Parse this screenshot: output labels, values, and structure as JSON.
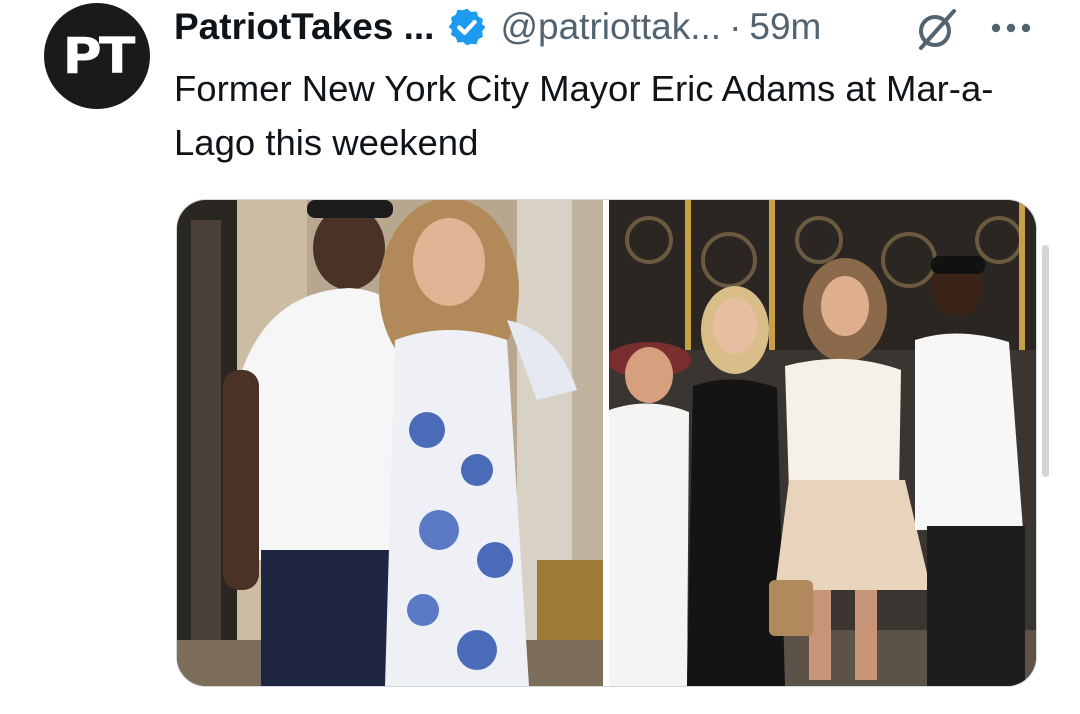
{
  "post": {
    "avatar": {
      "initials": "PT",
      "background": "#1a1a1a"
    },
    "author": {
      "display_name": "PatriotTakes ...",
      "verified": true,
      "handle": "@patriottak...",
      "separator": "·",
      "time_ago": "59m"
    },
    "icons": {
      "verified": "verified-badge-icon",
      "grok": "grok-icon",
      "more": "more-options-icon"
    },
    "text": "Former New York City Mayor Eric Adams at Mar-a-Lago this weekend",
    "media": {
      "count": 2
    }
  },
  "colors": {
    "text_primary": "#0f1419",
    "text_secondary": "#536471",
    "verified_blue": "#1d9bf0",
    "media_border": "#cfd9de"
  }
}
